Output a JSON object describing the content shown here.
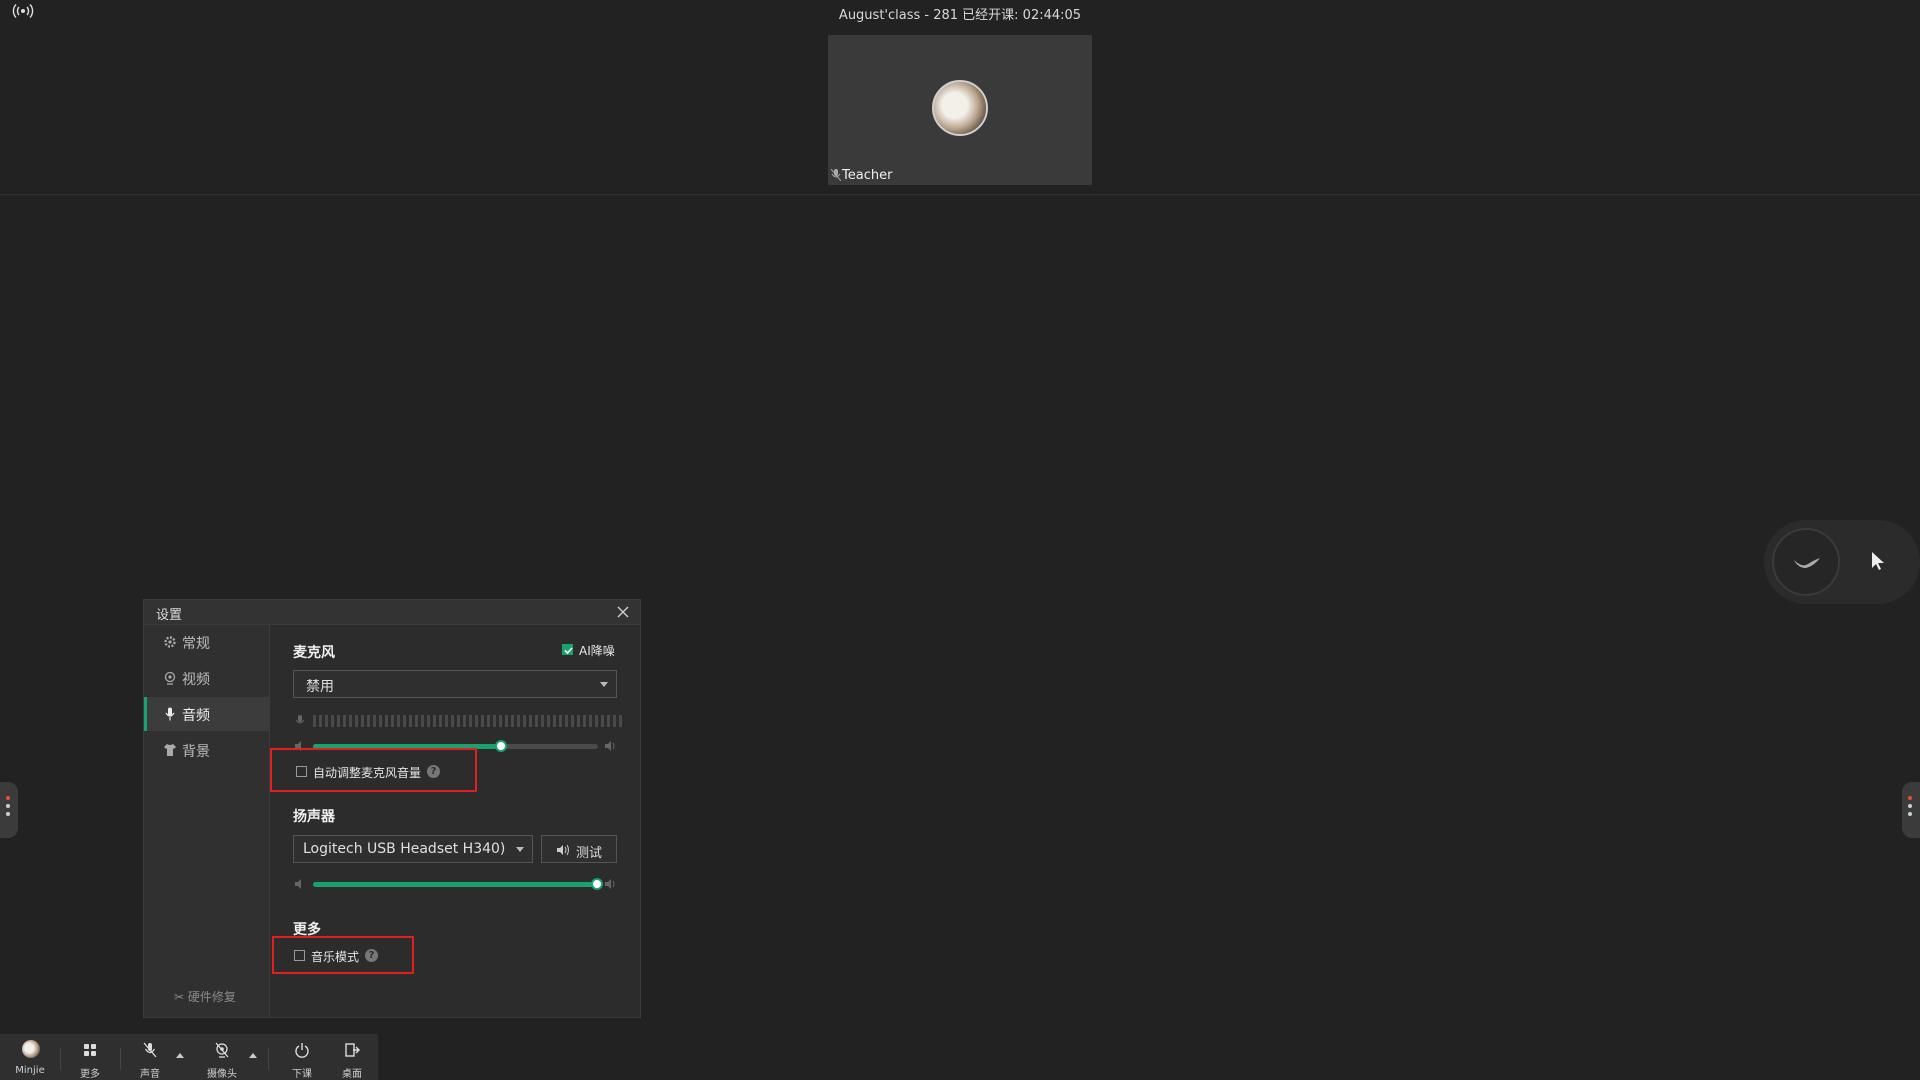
{
  "header": {
    "class_title": "August'class - 281   已经开课: 02:44:05"
  },
  "teacher_tile": {
    "name": "Teacher"
  },
  "settings_dialog": {
    "title": "设置",
    "nav": [
      {
        "label": "常规",
        "icon": "gear-icon"
      },
      {
        "label": "视频",
        "icon": "camera-icon"
      },
      {
        "label": "音频",
        "icon": "microphone-icon",
        "active": true
      },
      {
        "label": "背景",
        "icon": "shirt-icon"
      }
    ],
    "hardware_repair": "硬件修复",
    "microphone": {
      "title": "麦克风",
      "ai_noise_label": "AI降噪",
      "ai_noise_checked": true,
      "device": "禁用",
      "volume_percent": 66,
      "auto_adjust_label": "自动调整麦克风音量",
      "auto_adjust_checked": false
    },
    "speaker": {
      "title": "扬声器",
      "device": "Logitech USB Headset H340)",
      "test_label": "测试",
      "volume_percent": 100
    },
    "more": {
      "title": "更多",
      "music_mode_label": "音乐模式",
      "music_mode_checked": false
    }
  },
  "toolbar": {
    "user_label": "Minjie",
    "more_label": "更多",
    "audio_label": "声音",
    "camera_label": "摄像头",
    "end_class_label": "下课",
    "desktop_label": "桌面"
  },
  "colors": {
    "accent": "#19a170",
    "highlight": "#e02020",
    "background": "#222222"
  }
}
